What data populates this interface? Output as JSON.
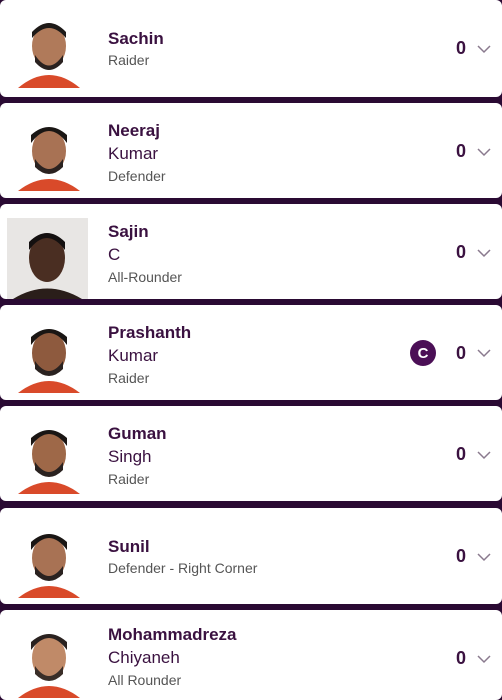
{
  "players": [
    {
      "first": "Sachin",
      "last": "",
      "role": "Raider",
      "points": "0",
      "captain": false,
      "photo": "player-photo"
    },
    {
      "first": "Neeraj",
      "last": "Kumar",
      "role": "Defender",
      "points": "0",
      "captain": false,
      "photo": "player-photo"
    },
    {
      "first": "Sajin",
      "last": "C",
      "role": "All-Rounder",
      "points": "0",
      "captain": false,
      "photo": "player-photo-placeholder"
    },
    {
      "first": "Prashanth",
      "last": "Kumar",
      "role": "Raider",
      "points": "0",
      "captain": true,
      "captain_label": "C",
      "photo": "player-photo"
    },
    {
      "first": "Guman",
      "last": "Singh",
      "role": "Raider",
      "points": "0",
      "captain": false,
      "photo": "player-photo"
    },
    {
      "first": "Sunil",
      "last": "",
      "role": "Defender - Right Corner",
      "points": "0",
      "captain": false,
      "photo": "player-photo"
    },
    {
      "first": "Mohammadreza",
      "last": "Chiyaneh",
      "role": "All Rounder",
      "points": "0",
      "captain": false,
      "photo": "player-photo"
    }
  ],
  "colors": {
    "accent": "#4b0f56",
    "divider": "#2a0a33",
    "text": "#3a1140"
  },
  "icons": {
    "expand": "chevron-down-icon",
    "captain": "captain-badge"
  }
}
